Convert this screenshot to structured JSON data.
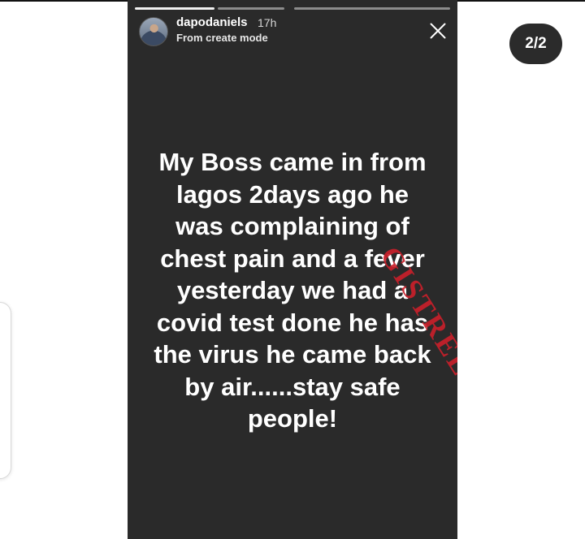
{
  "story": {
    "username": "dapodaniels",
    "time_ago": "17h",
    "subtitle": "From create mode",
    "text": "My Boss came in from\nlagos 2days ago he\nwas complaining of\nchest pain and a fever\nyesterday we had a\ncovid test done he has\nthe virus he came back\nby air......stay safe\npeople!",
    "watermark": "GISTREEL"
  },
  "pager": {
    "label": "2/2"
  },
  "icons": {
    "close": "close-icon",
    "avatar": "avatar"
  },
  "colors": {
    "story_bg": "#2a2a2a",
    "watermark": "#c8202a",
    "badge_bg": "#2b2b2b"
  }
}
